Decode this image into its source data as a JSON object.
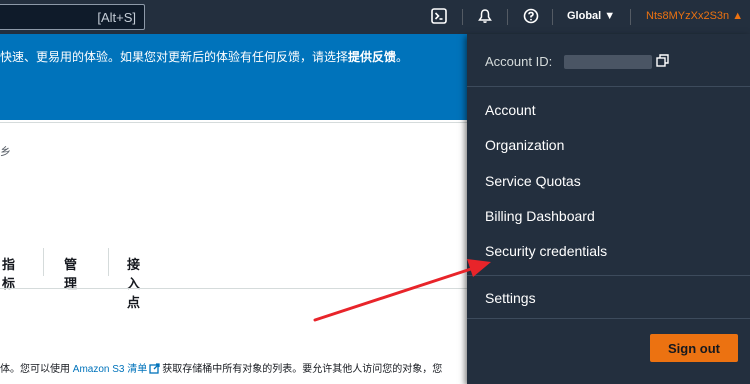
{
  "topnav": {
    "search_hint": "[Alt+S]",
    "cloudshell_icon": "terminal-icon",
    "notifications_icon": "bell-icon",
    "help_icon": "help-circle-icon",
    "region_label": "Global ▼",
    "account_label": "Nts8MYzXx2S3n ▲"
  },
  "banner": {
    "text": "快速、更易用的体验。如果您对更新后的体验有任何反馈，请选择",
    "link": "提供反馈",
    "end": "。"
  },
  "page": {
    "side_mark": "乡",
    "tabs": [
      "指标",
      "管理",
      "接入点"
    ],
    "bottom_text_before": "体。您可以使用",
    "bottom_link": "Amazon S3 清单",
    "bottom_text_after": "获取存储桶中所有对象的列表。要允许其他人访问您的对象，您"
  },
  "dropdown": {
    "account_id_label": "Account ID:",
    "items": [
      "Account",
      "Organization",
      "Service Quotas",
      "Billing Dashboard",
      "Security credentials",
      "Settings"
    ],
    "sign_out": "Sign out"
  },
  "colors": {
    "nav_bg": "#232f3e",
    "banner_bg": "#0073bb",
    "accent": "#ec7211",
    "annotation": "#e8242a"
  }
}
